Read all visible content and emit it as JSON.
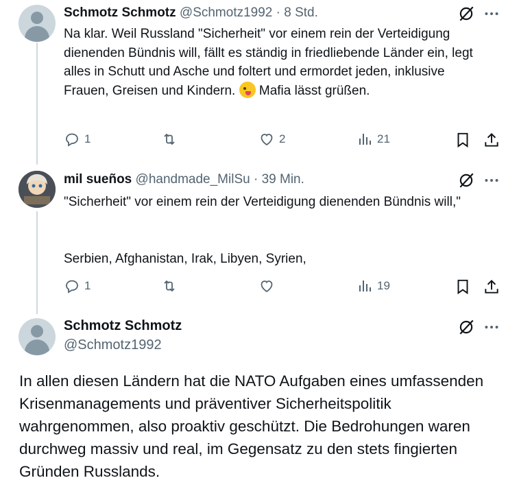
{
  "tweets": [
    {
      "name": "Schmotz Schmotz",
      "handle": "@Schmotz1992",
      "time": " · 8 Std.",
      "text_before_emoji": "Na klar. Weil Russland \"Sicherheit\" vor einem rein der Verteidigung dienenden Bündnis will, fällt es ständig in friedliebende Länder ein, legt alles in Schutt und Asche und foltert und ermordet jeden, inklusive Frauen, Greisen und Kindern. ",
      "text_after_emoji": " Mafia lässt grüßen.",
      "emoji_icon": "zany-face-emoji",
      "replies": "1",
      "retweets": "",
      "likes": "2",
      "views": "21"
    },
    {
      "name": "mil sueños",
      "handle": "@handmade_MilSu",
      "time": " · 39 Min.",
      "text": "\"Sicherheit\" vor einem rein der Verteidigung dienenden Bündnis will,\"\n\n\nSerbien, Afghanistan, Irak, Libyen, Syrien,",
      "replies": "1",
      "retweets": "",
      "likes": "",
      "views": "19"
    }
  ],
  "main_tweet": {
    "name": "Schmotz Schmotz",
    "handle": "@Schmotz1992",
    "text": "In allen diesen Ländern hat die NATO Aufgaben eines umfassenden Krisenmanagements und präventiver Sicherheitspolitik wahrgenommen, also proaktiv geschützt. Die Bedrohungen waren durchweg massiv und real, im Gegensatz zu den stets fingierten Gründen Russlands."
  },
  "colors": {
    "text": "#0f1419",
    "secondary": "#536471",
    "line": "#cfd9de"
  }
}
